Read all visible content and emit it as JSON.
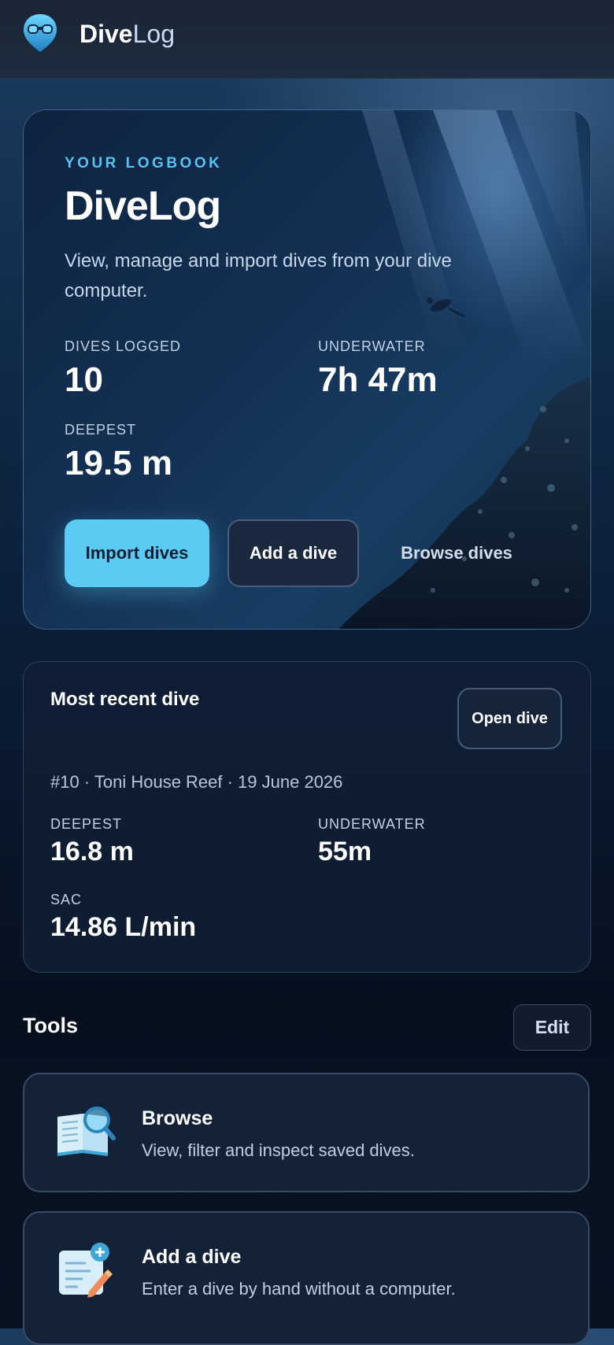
{
  "app": {
    "brand_bold": "Dive",
    "brand_light": "Log"
  },
  "hero": {
    "eyebrow": "YOUR LOGBOOK",
    "title": "DiveLog",
    "description": "View, manage and import dives from your dive computer.",
    "stats": [
      {
        "label": "DIVES LOGGED",
        "value": "10"
      },
      {
        "label": "UNDERWATER",
        "value": "7h 47m"
      },
      {
        "label": "DEEPEST",
        "value": "19.5 m"
      }
    ],
    "buttons": {
      "import": "Import dives",
      "add": "Add a dive",
      "browse": "Browse dives"
    }
  },
  "recent": {
    "title": "Most recent dive",
    "open_label": "Open dive",
    "meta": "#10 · Toni House Reef · 19 June 2026",
    "stats": [
      {
        "label": "DEEPEST",
        "value": "16.8 m"
      },
      {
        "label": "UNDERWATER",
        "value": "55m"
      },
      {
        "label": "SAC",
        "value": "14.86 L/min"
      }
    ]
  },
  "tools": {
    "title": "Tools",
    "edit_label": "Edit",
    "items": [
      {
        "name": "Browse",
        "description": "View, filter and inspect saved dives.",
        "icon": "book-magnifier-icon"
      },
      {
        "name": "Add a dive",
        "description": "Enter a dive by hand without a computer.",
        "icon": "add-document-icon"
      }
    ]
  },
  "colors": {
    "accent": "#5ccbf3",
    "eyebrow": "#56c3f0",
    "card": "#142237"
  }
}
